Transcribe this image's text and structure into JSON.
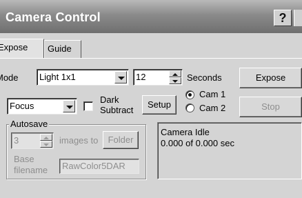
{
  "window": {
    "title": "Camera Control",
    "help_label": "?"
  },
  "tabs": [
    {
      "label": "Expose",
      "active": true
    },
    {
      "label": "Guide",
      "active": false
    }
  ],
  "expose": {
    "mode_label": "Mode",
    "mode_value": "Light 1x1",
    "exposure_value": "12",
    "seconds_label": "Seconds",
    "expose_button": "Expose",
    "focus_value": "Focus",
    "dark_subtract_line1": "Dark",
    "dark_subtract_line2": "Subtract",
    "dark_subtract_checked": false,
    "setup_button": "Setup",
    "cam1_label": "Cam 1",
    "cam2_label": "Cam 2",
    "selected_camera": "Cam 1",
    "stop_button": "Stop"
  },
  "autosave": {
    "title": "Autosave",
    "count_value": "3",
    "images_to_label": "images to",
    "folder_button": "Folder",
    "base_label_line1": "Base",
    "base_label_line2": "filename",
    "base_filename_value": "RawColor5DAR"
  },
  "status": {
    "line1": "Camera Idle",
    "line2": "0.000 of 0.000 sec"
  }
}
